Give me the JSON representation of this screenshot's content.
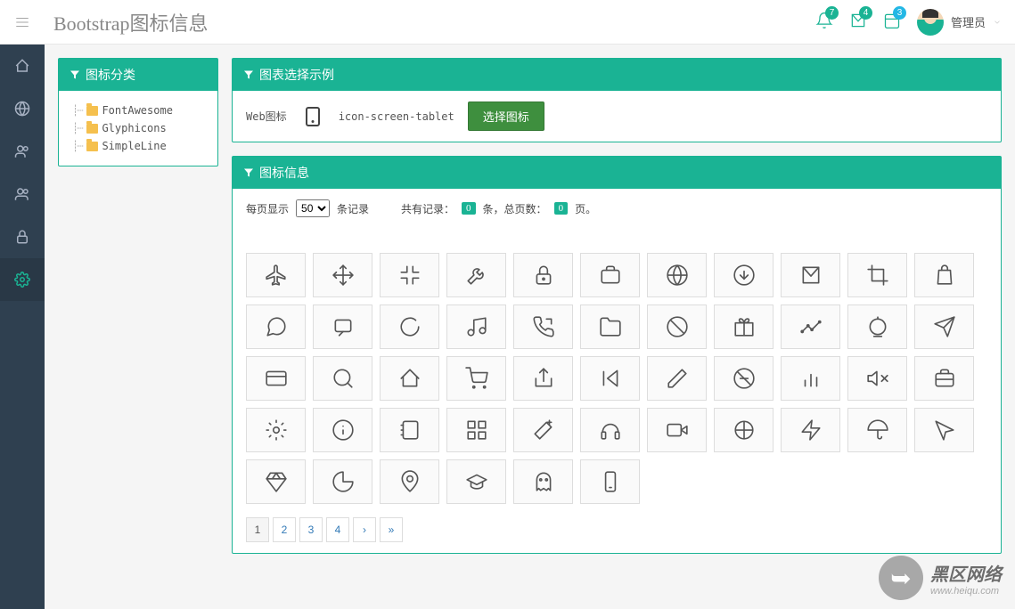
{
  "header": {
    "title": "Bootstrap图标信息",
    "notifications": [
      {
        "count": "7"
      },
      {
        "count": "4"
      },
      {
        "count": "3"
      }
    ],
    "user_label": "管理员"
  },
  "tree_panel": {
    "title": "图标分类",
    "items": [
      "FontAwesome",
      "Glyphicons",
      "SimpleLine"
    ]
  },
  "example_panel": {
    "title": "图表选择示例",
    "label": "Web图标",
    "icon_code": "icon-screen-tablet",
    "button": "选择图标"
  },
  "info_panel": {
    "title": "图标信息",
    "per_page_prefix": "每页显示",
    "per_page_value": "50",
    "per_page_suffix": "条记录",
    "total_prefix": "共有记录：",
    "total_records": "0",
    "total_mid": "条，总页数：",
    "total_pages": "0",
    "total_suffix": "页。"
  },
  "icons_row1": [
    "plane",
    "arrows",
    "compress",
    "wrench",
    "lock",
    "briefcase",
    "globe",
    "download",
    "envelope",
    "crop",
    "bag"
  ],
  "icons_row2": [
    "comment",
    "loop",
    "refresh",
    "music",
    "phone",
    "folder",
    "ban",
    "gift",
    "chart-line",
    "trophy",
    "paper-plane"
  ],
  "icons_row3": [
    "credit-card",
    "search",
    "home",
    "cart",
    "share",
    "prev",
    "pencil",
    "no-smoking",
    "bar-chart",
    "mute",
    "suitcase"
  ],
  "icons_row4": [
    "gear",
    "info",
    "notebook",
    "grid",
    "magic-wand",
    "headset",
    "video",
    "target",
    "bolt",
    "umbrella",
    "cursor"
  ],
  "icons_row5": [
    "diamond",
    "pie",
    "location",
    "graduation",
    "ghost",
    "phone-device"
  ],
  "pagination": {
    "pages": [
      "1",
      "2",
      "3",
      "4"
    ],
    "next": "›",
    "last": "»"
  },
  "watermark": {
    "main": "黑区网络",
    "sub": "www.heiqu.com"
  }
}
